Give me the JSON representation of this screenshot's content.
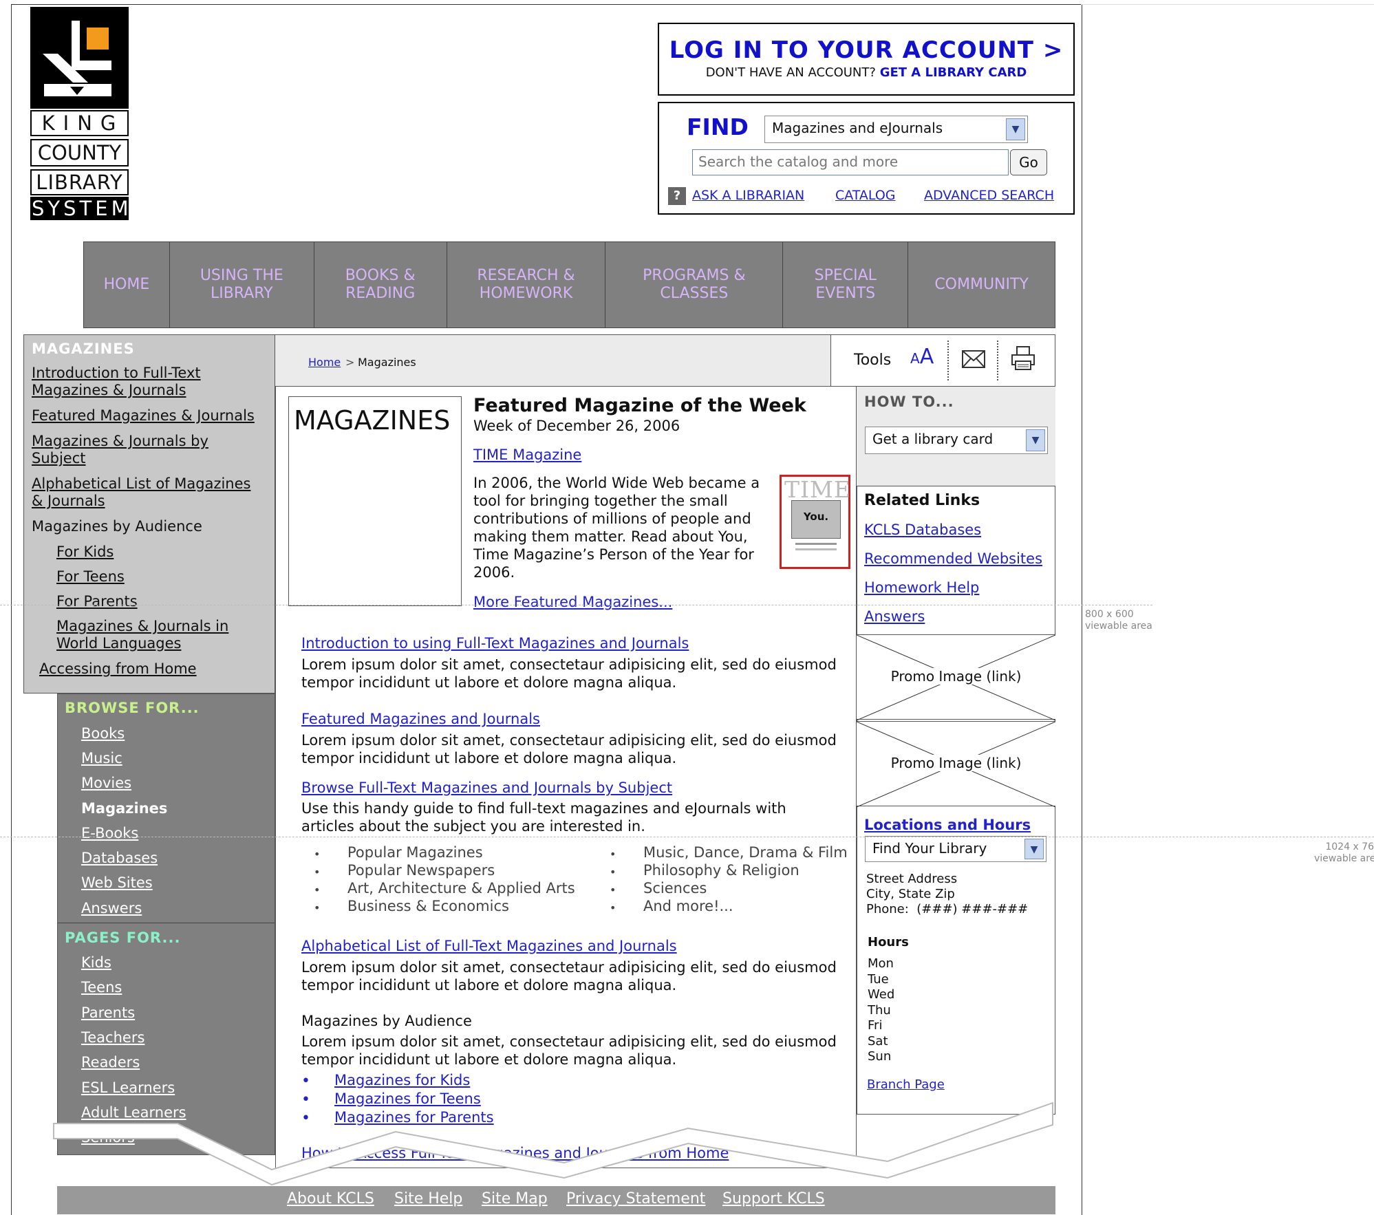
{
  "logo": {
    "words": [
      "KING",
      "COUNTY",
      "LIBRARY",
      "SYSTEM"
    ]
  },
  "account": {
    "title": "LOG IN TO YOUR ACCOUNT >",
    "no_account": "DON'T HAVE AN ACCOUNT?",
    "get_card": "GET A LIBRARY CARD"
  },
  "find": {
    "label": "FIND",
    "scope_value": "Magazines and eJournals",
    "search_placeholder": "Search the catalog and more",
    "go": "Go",
    "help_icon": "?",
    "links": [
      "ASK A LIBRARIAN",
      "CATALOG",
      "ADVANCED SEARCH"
    ]
  },
  "nav": [
    "HOME",
    "USING THE LIBRARY",
    "BOOKS & READING",
    "RESEARCH & HOMEWORK",
    "PROGRAMS & CLASSES",
    "SPECIAL EVENTS",
    "COMMUNITY"
  ],
  "left_nav": {
    "heading": "MAGAZINES",
    "items": [
      "Introduction to Full-Text Magazines & Journals",
      "Featured Magazines & Journals",
      "Magazines & Journals by Subject",
      "Alphabetical List of Magazines & Journals",
      "Magazines by Audience",
      "For Kids",
      "For Teens",
      "For Parents",
      "Magazines & Journals in World Languages",
      "Accessing from Home"
    ]
  },
  "browse": {
    "heading": "BROWSE FOR...",
    "items": [
      "Books",
      "Music",
      "Movies",
      "Magazines",
      "E-Books",
      "Databases",
      "Web Sites",
      "Answers"
    ],
    "pages_heading": "PAGES FOR...",
    "pages": [
      "Kids",
      "Teens",
      "Parents",
      "Teachers",
      "Readers",
      "ESL Learners",
      "Adult Learners",
      "Seniors"
    ]
  },
  "breadcrumb": {
    "home": "Home",
    "sep": ">",
    "current": "Magazines"
  },
  "tools": {
    "label": "Tools",
    "text_size": "AA",
    "email_icon": "envelope-icon",
    "print_icon": "printer-icon"
  },
  "featured": {
    "box_title": "MAGAZINES",
    "heading": "Featured Magazine of the Week",
    "week": "Week of December 26, 2006",
    "magazine_link": "TIME Magazine",
    "description": "In 2006, the World Wide Web became a tool for bringing together the small contributions of millions of people and making them matter.  Read about You, Time Magazine’s Person of the Year for 2006.",
    "cover_masthead": "TIME",
    "cover_word": "You.",
    "more": "More Featured Magazines..."
  },
  "sections": [
    {
      "link": "Introduction to using Full-Text Magazines and Journals",
      "text": "Lorem ipsum dolor sit amet, consectetaur adipisicing elit, sed do eiusmod tempor incididunt ut labore et dolore magna aliqua."
    },
    {
      "link": "Featured Magazines and Journals",
      "text": "Lorem ipsum dolor sit amet, consectetaur adipisicing elit, sed do eiusmod tempor incididunt ut labore et dolore magna aliqua."
    },
    {
      "link": "Browse Full-Text Magazines and Journals by Subject",
      "text": "Use this handy guide to find full-text magazines and eJournals with articles about the subject you are interested in."
    },
    {
      "link": "Alphabetical List of Full-Text Magazines and Journals",
      "text": "Lorem ipsum dolor sit amet, consectetaur adipisicing elit, sed do eiusmod tempor incididunt ut labore et dolore magna aliqua."
    }
  ],
  "subjects_left": [
    "Popular Magazines",
    "Popular Newspapers",
    "Art, Architecture & Applied Arts",
    "Business & Economics"
  ],
  "subjects_right": [
    "Music, Dance, Drama & Film",
    "Philosophy & Religion",
    "Sciences",
    "And more!..."
  ],
  "audience": {
    "title": "Magazines by Audience",
    "text": "Lorem ipsum dolor sit amet, consectetaur adipisicing elit, sed do eiusmod tempor incididunt ut labore et dolore magna aliqua.",
    "links": [
      "Magazines for Kids",
      "Magazines for Teens",
      "Magazines for Parents"
    ]
  },
  "access_home_link": "How to Access Full-Text Magazines and Journals from Home",
  "right": {
    "howto_heading": "HOW TO...",
    "howto_value": "Get a library card",
    "related_heading": "Related Links",
    "related": [
      "KCLS Databases",
      "Recommended Websites",
      "Homework Help",
      "Answers"
    ],
    "promo": [
      "Promo Image (link)",
      "Promo Image (link)"
    ],
    "locations_heading": "Locations and Hours",
    "location_value": "Find Your Library",
    "address": [
      "Street Address",
      "City, State Zip",
      "Phone:  (###) ###-###"
    ],
    "hours_heading": "Hours",
    "days": [
      "Mon",
      "Tue",
      "Wed",
      "Thu",
      "Fri",
      "Sat",
      "Sun"
    ],
    "branch": "Branch Page"
  },
  "footer": [
    "About KCLS",
    "Site Help",
    "Site Map",
    "Privacy Statement",
    "Support KCLS"
  ],
  "guides": {
    "g800": [
      "800 x 600",
      "viewable area"
    ],
    "g1024": [
      "1024 x 76",
      "viewable are"
    ]
  }
}
